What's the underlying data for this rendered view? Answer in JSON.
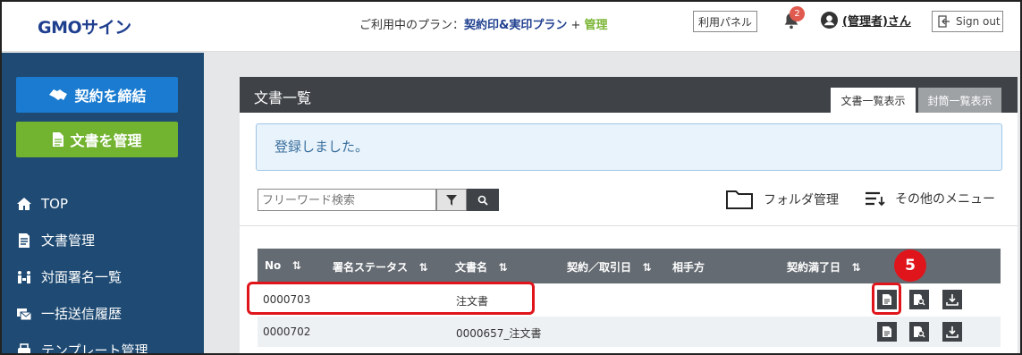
{
  "header": {
    "logo": "GMOサイン",
    "plan_prefix": "ご利用中のプラン：",
    "plan_name": "契約印&実印プラン",
    "plan_plus": " + ",
    "plan_extra": "管理",
    "panel_button": "利用パネル",
    "notification_count": "2",
    "user_name": "(管理者)さん",
    "signout": "Sign out"
  },
  "sidebar": {
    "contract_button": "契約を締結",
    "docs_button": "文書を管理",
    "items": [
      {
        "label": "TOP",
        "icon": "home-icon"
      },
      {
        "label": "文書管理",
        "icon": "document-icon"
      },
      {
        "label": "対面署名一覧",
        "icon": "face-sign-icon"
      },
      {
        "label": "一括送信履歴",
        "icon": "bulk-send-icon"
      },
      {
        "label": "テンプレート管理",
        "icon": "template-icon"
      }
    ]
  },
  "panel": {
    "title": "文書一覧",
    "tab_active": "文書一覧表示",
    "tab_inactive": "封筒一覧表示",
    "alert": "登録しました。",
    "search_placeholder": "フリーワード検索",
    "folder_label": "フォルダ管理",
    "other_menu": "その他のメニュー"
  },
  "table": {
    "headers": [
      "No",
      "署名ステータス",
      "文書名",
      "契約／取引日",
      "相手方",
      "契約満了日"
    ],
    "sort_glyph": "⇅",
    "rows": [
      {
        "no": "0000703",
        "status": "",
        "name": "注文書",
        "date": "",
        "party": "",
        "expiry": ""
      },
      {
        "no": "0000702",
        "status": "",
        "name": "0000657_注文書",
        "date": "",
        "party": "",
        "expiry": ""
      }
    ]
  },
  "annotation": {
    "step": "5",
    "color": "#e0151c"
  },
  "colors": {
    "sidebar": "#1e4a73",
    "contract_button": "#1a7bd0",
    "docs_button": "#72b330",
    "panel_header": "#3f4347",
    "table_header": "#656b72"
  }
}
